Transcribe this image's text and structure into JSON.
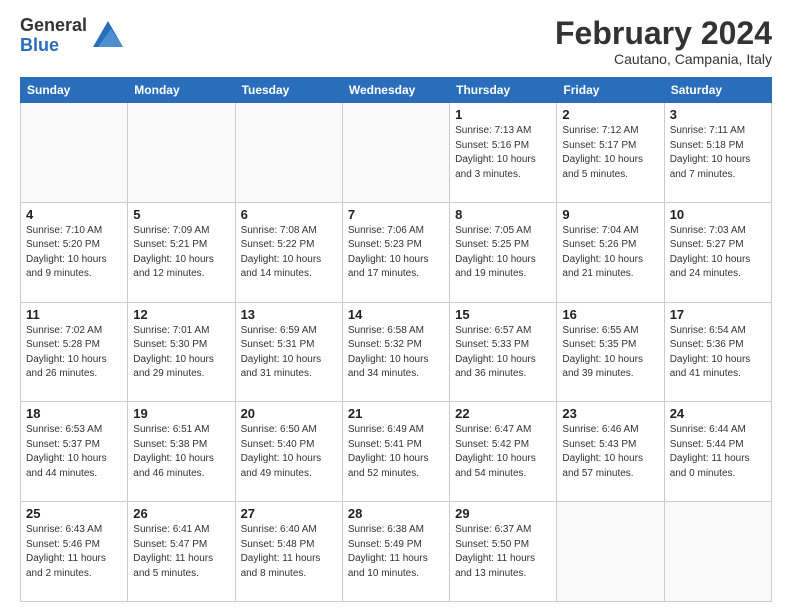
{
  "header": {
    "logo_general": "General",
    "logo_blue": "Blue",
    "month_title": "February 2024",
    "location": "Cautano, Campania, Italy"
  },
  "weekdays": [
    "Sunday",
    "Monday",
    "Tuesday",
    "Wednesday",
    "Thursday",
    "Friday",
    "Saturday"
  ],
  "weeks": [
    [
      {
        "day": "",
        "info": ""
      },
      {
        "day": "",
        "info": ""
      },
      {
        "day": "",
        "info": ""
      },
      {
        "day": "",
        "info": ""
      },
      {
        "day": "1",
        "info": "Sunrise: 7:13 AM\nSunset: 5:16 PM\nDaylight: 10 hours\nand 3 minutes."
      },
      {
        "day": "2",
        "info": "Sunrise: 7:12 AM\nSunset: 5:17 PM\nDaylight: 10 hours\nand 5 minutes."
      },
      {
        "day": "3",
        "info": "Sunrise: 7:11 AM\nSunset: 5:18 PM\nDaylight: 10 hours\nand 7 minutes."
      }
    ],
    [
      {
        "day": "4",
        "info": "Sunrise: 7:10 AM\nSunset: 5:20 PM\nDaylight: 10 hours\nand 9 minutes."
      },
      {
        "day": "5",
        "info": "Sunrise: 7:09 AM\nSunset: 5:21 PM\nDaylight: 10 hours\nand 12 minutes."
      },
      {
        "day": "6",
        "info": "Sunrise: 7:08 AM\nSunset: 5:22 PM\nDaylight: 10 hours\nand 14 minutes."
      },
      {
        "day": "7",
        "info": "Sunrise: 7:06 AM\nSunset: 5:23 PM\nDaylight: 10 hours\nand 17 minutes."
      },
      {
        "day": "8",
        "info": "Sunrise: 7:05 AM\nSunset: 5:25 PM\nDaylight: 10 hours\nand 19 minutes."
      },
      {
        "day": "9",
        "info": "Sunrise: 7:04 AM\nSunset: 5:26 PM\nDaylight: 10 hours\nand 21 minutes."
      },
      {
        "day": "10",
        "info": "Sunrise: 7:03 AM\nSunset: 5:27 PM\nDaylight: 10 hours\nand 24 minutes."
      }
    ],
    [
      {
        "day": "11",
        "info": "Sunrise: 7:02 AM\nSunset: 5:28 PM\nDaylight: 10 hours\nand 26 minutes."
      },
      {
        "day": "12",
        "info": "Sunrise: 7:01 AM\nSunset: 5:30 PM\nDaylight: 10 hours\nand 29 minutes."
      },
      {
        "day": "13",
        "info": "Sunrise: 6:59 AM\nSunset: 5:31 PM\nDaylight: 10 hours\nand 31 minutes."
      },
      {
        "day": "14",
        "info": "Sunrise: 6:58 AM\nSunset: 5:32 PM\nDaylight: 10 hours\nand 34 minutes."
      },
      {
        "day": "15",
        "info": "Sunrise: 6:57 AM\nSunset: 5:33 PM\nDaylight: 10 hours\nand 36 minutes."
      },
      {
        "day": "16",
        "info": "Sunrise: 6:55 AM\nSunset: 5:35 PM\nDaylight: 10 hours\nand 39 minutes."
      },
      {
        "day": "17",
        "info": "Sunrise: 6:54 AM\nSunset: 5:36 PM\nDaylight: 10 hours\nand 41 minutes."
      }
    ],
    [
      {
        "day": "18",
        "info": "Sunrise: 6:53 AM\nSunset: 5:37 PM\nDaylight: 10 hours\nand 44 minutes."
      },
      {
        "day": "19",
        "info": "Sunrise: 6:51 AM\nSunset: 5:38 PM\nDaylight: 10 hours\nand 46 minutes."
      },
      {
        "day": "20",
        "info": "Sunrise: 6:50 AM\nSunset: 5:40 PM\nDaylight: 10 hours\nand 49 minutes."
      },
      {
        "day": "21",
        "info": "Sunrise: 6:49 AM\nSunset: 5:41 PM\nDaylight: 10 hours\nand 52 minutes."
      },
      {
        "day": "22",
        "info": "Sunrise: 6:47 AM\nSunset: 5:42 PM\nDaylight: 10 hours\nand 54 minutes."
      },
      {
        "day": "23",
        "info": "Sunrise: 6:46 AM\nSunset: 5:43 PM\nDaylight: 10 hours\nand 57 minutes."
      },
      {
        "day": "24",
        "info": "Sunrise: 6:44 AM\nSunset: 5:44 PM\nDaylight: 11 hours\nand 0 minutes."
      }
    ],
    [
      {
        "day": "25",
        "info": "Sunrise: 6:43 AM\nSunset: 5:46 PM\nDaylight: 11 hours\nand 2 minutes."
      },
      {
        "day": "26",
        "info": "Sunrise: 6:41 AM\nSunset: 5:47 PM\nDaylight: 11 hours\nand 5 minutes."
      },
      {
        "day": "27",
        "info": "Sunrise: 6:40 AM\nSunset: 5:48 PM\nDaylight: 11 hours\nand 8 minutes."
      },
      {
        "day": "28",
        "info": "Sunrise: 6:38 AM\nSunset: 5:49 PM\nDaylight: 11 hours\nand 10 minutes."
      },
      {
        "day": "29",
        "info": "Sunrise: 6:37 AM\nSunset: 5:50 PM\nDaylight: 11 hours\nand 13 minutes."
      },
      {
        "day": "",
        "info": ""
      },
      {
        "day": "",
        "info": ""
      }
    ]
  ]
}
